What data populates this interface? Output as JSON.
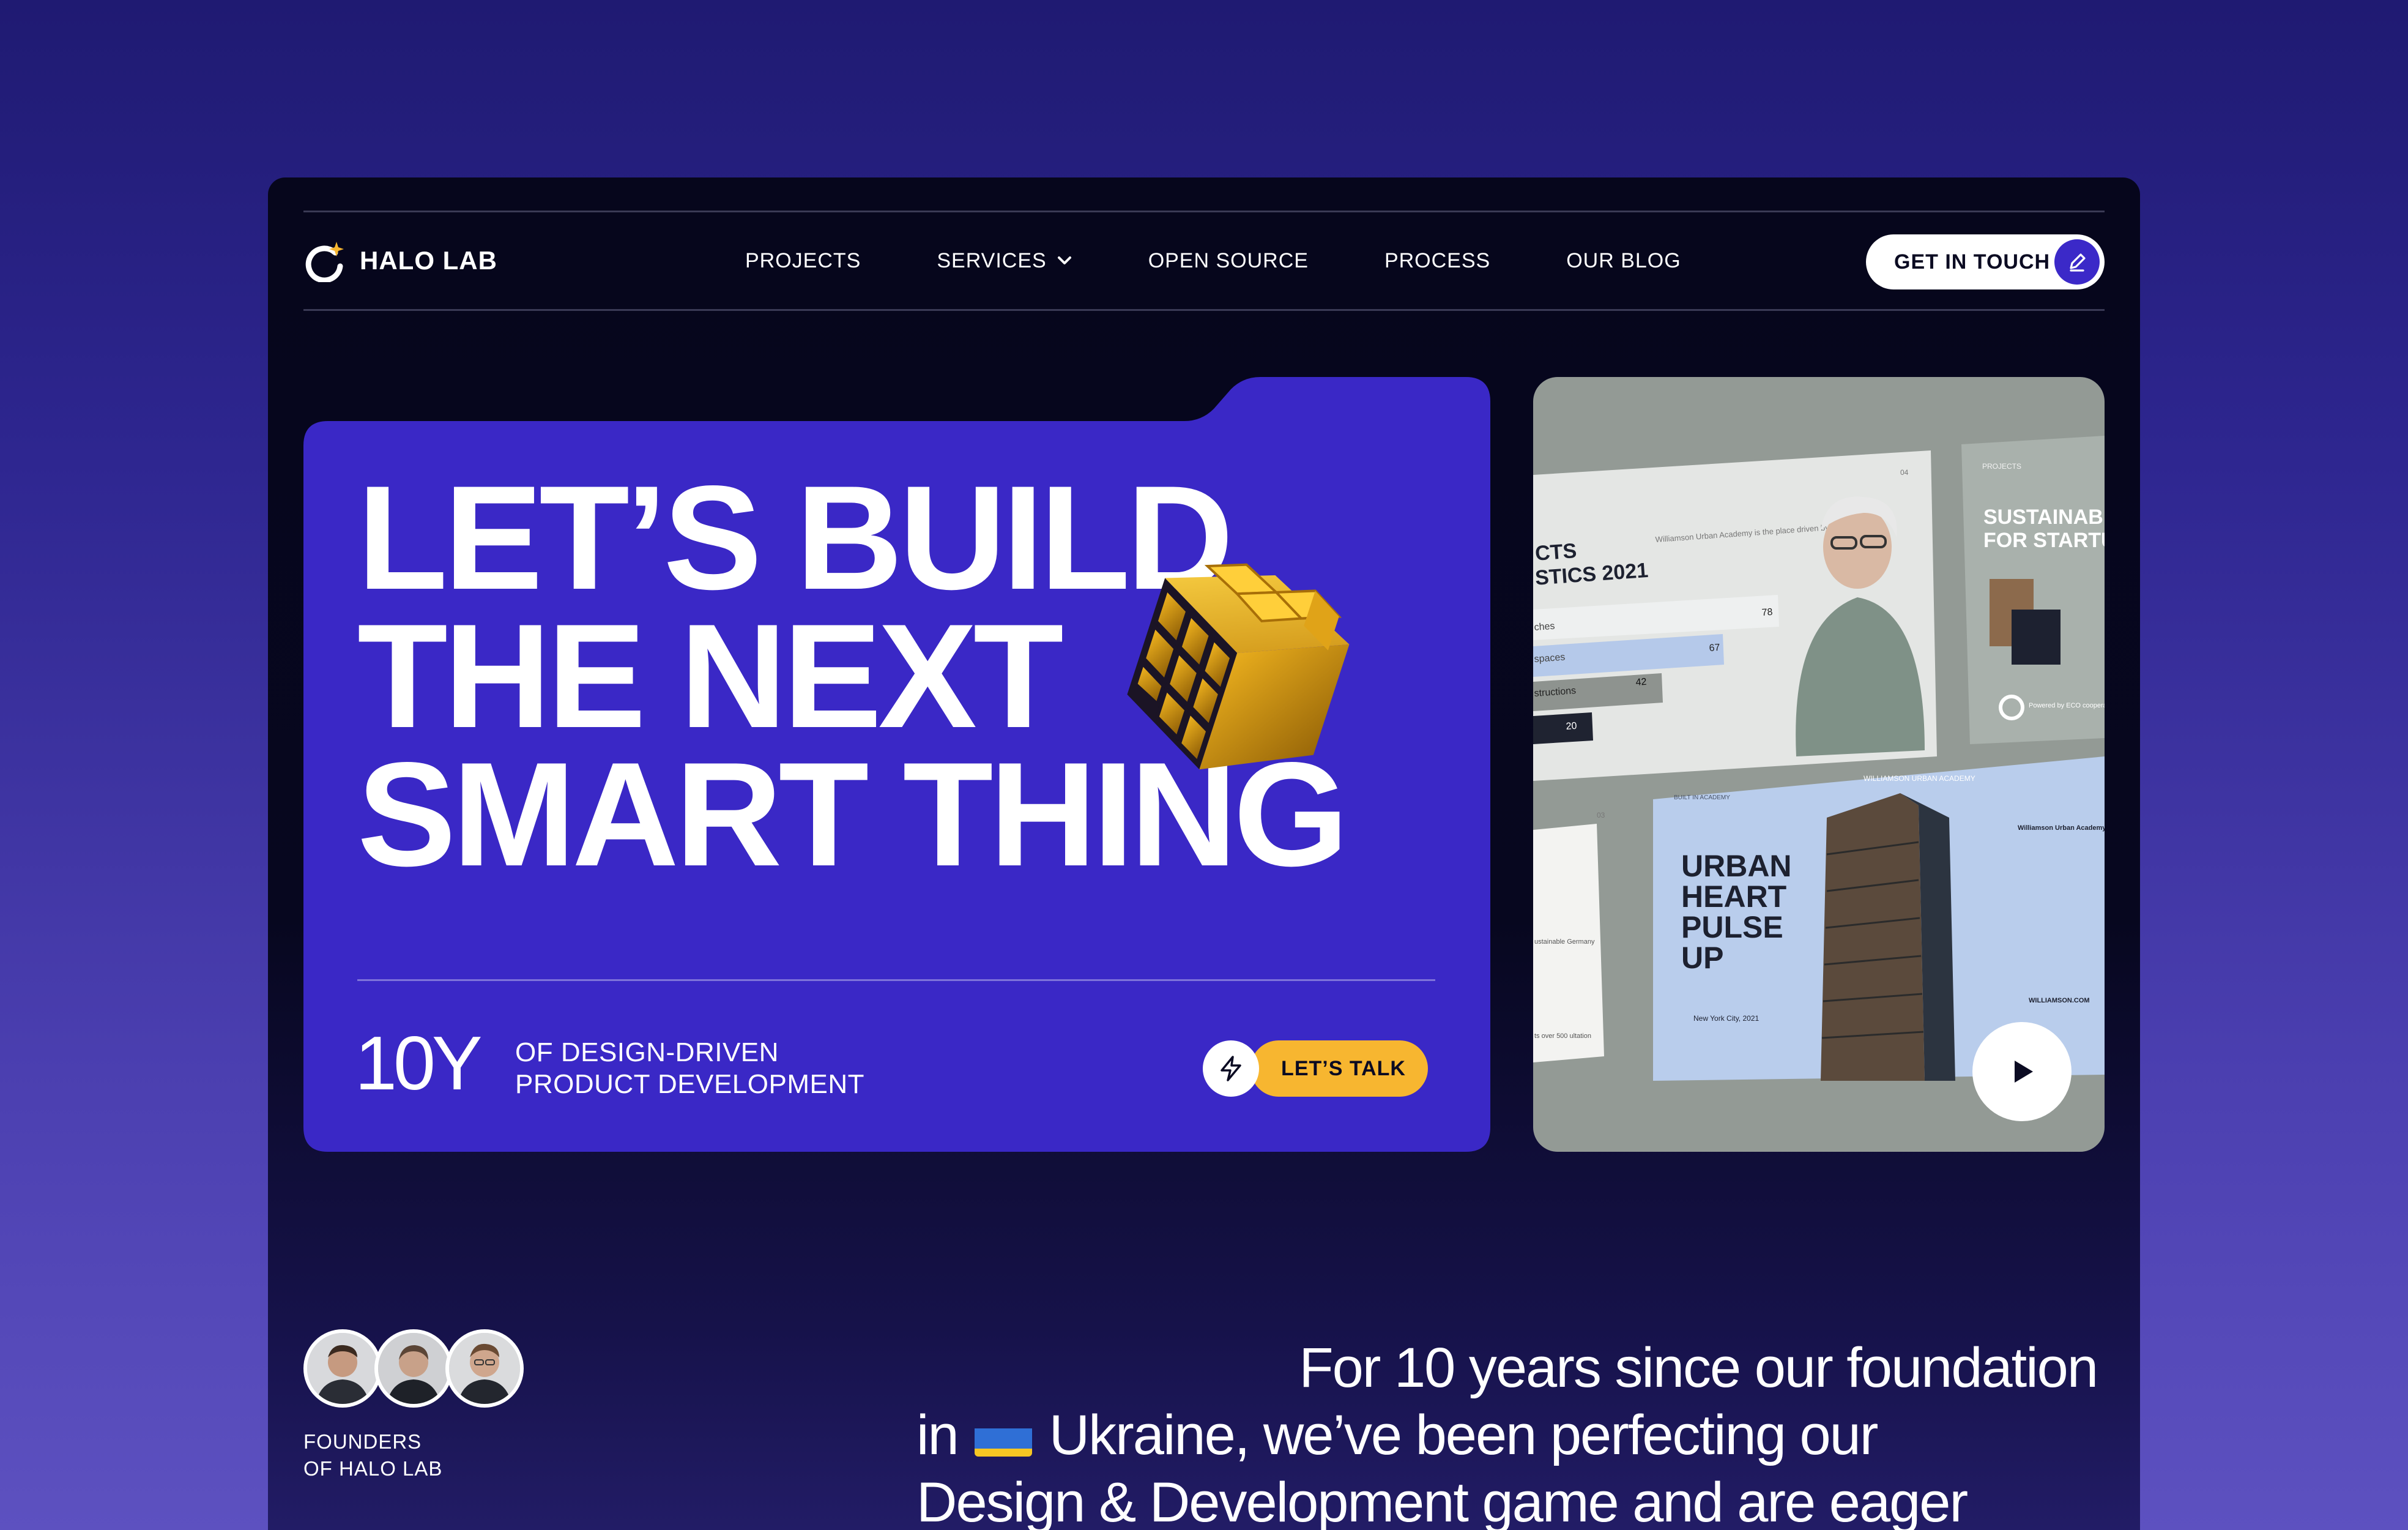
{
  "nav": {
    "logo_text": "HALO LAB",
    "items": [
      {
        "label": "PROJECTS"
      },
      {
        "label": "SERVICES",
        "has_dropdown": true
      },
      {
        "label": "OPEN SOURCE"
      },
      {
        "label": "PROCESS"
      },
      {
        "label": "OUR BLOG"
      }
    ],
    "cta_label": "GET IN TOUCH"
  },
  "hero": {
    "title_lines": [
      "LET’S BUILD",
      "THE NEXT",
      "SMART THING"
    ],
    "stat_number": "10Y",
    "stat_text_lines": [
      "OF DESIGN-DRIVEN",
      "PRODUCT DEVELOPMENT"
    ],
    "talk_button": "LET’S TALK"
  },
  "preview": {
    "card1_heading_lines": [
      "CTS",
      "STICS 2021"
    ],
    "card1_description": "Williamson Urban Academy is the place driven by curiosity.",
    "card1_bars": [
      {
        "label": "ches",
        "value": "78"
      },
      {
        "label": "spaces",
        "value": "67"
      },
      {
        "label": "structions",
        "value": "42"
      },
      {
        "label": "",
        "value": "20"
      }
    ],
    "card1_corner": "04",
    "card2_tag": "PROJECTS",
    "card2_heading_lines": [
      "SUSTAINABIL",
      "FOR STARTU"
    ],
    "card2_footer": "Powered by ECO cooperation",
    "card3_heading_lines": [
      "URBAN",
      "HEART",
      "PULSE",
      "UP"
    ],
    "card3_top_label": "WILLIAMSON URBAN ACADEMY",
    "card3_corner": "BUILT IN ACADEMY",
    "card3_location": "New York City, 2021",
    "card3_side_title": "Williamson Urban Academy",
    "card3_site": "WILLIAMSON.COM",
    "card4_corner": "03",
    "card4_text": "ustainable Germany",
    "card4_bottom": "ts over 500 ultation"
  },
  "founders": {
    "label_lines": [
      "FOUNDERS",
      "OF HALO LAB"
    ],
    "count": 3
  },
  "intro": {
    "line1": "For 10 years since our foundation",
    "line2_before": "in",
    "line2_after": "Ukraine, we’ve been perfecting our",
    "line3": "Design & Development game and are eager"
  },
  "colors": {
    "accent_blue": "#3b29c8",
    "accent_yellow": "#f7b630",
    "page_bg": "#06061c",
    "preview_bg": "#939a95"
  },
  "icons": {
    "logo": "halo-logo-icon",
    "dropdown": "chevron-down-icon",
    "cta": "pencil-icon",
    "talk": "lightning-icon",
    "play": "play-icon"
  }
}
